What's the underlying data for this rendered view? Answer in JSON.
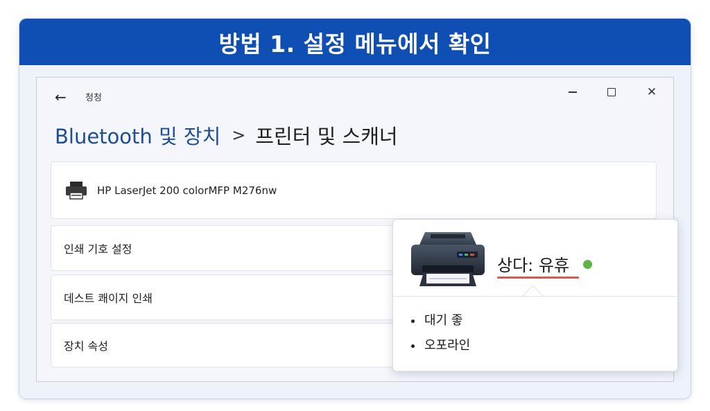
{
  "banner": {
    "title": "방법 1. 설정 메뉴에서 확인",
    "color": "#0f4fb3"
  },
  "window": {
    "title": "청청",
    "back_icon": "back-arrow-icon",
    "controls": [
      "minimize-icon",
      "maximize-icon",
      "close-icon"
    ]
  },
  "breadcrumb": {
    "parent": "Bluetooth 및 장치",
    "separator": ">",
    "current": "프린터 및 스캐너"
  },
  "printer": {
    "name": "HP LaserJet 200 colorMFP M276nw",
    "icon": "printer-icon"
  },
  "rows": {
    "preferences": "인쇄 기호 설정",
    "test_page": "데스트 쾌이지 인쇄",
    "properties": "장치 속성"
  },
  "popup": {
    "status": "상다: 유휴",
    "status_color": "#5db346",
    "underline_color": "#e0564a",
    "items": [
      "대기 좋",
      "오포라인"
    ]
  }
}
